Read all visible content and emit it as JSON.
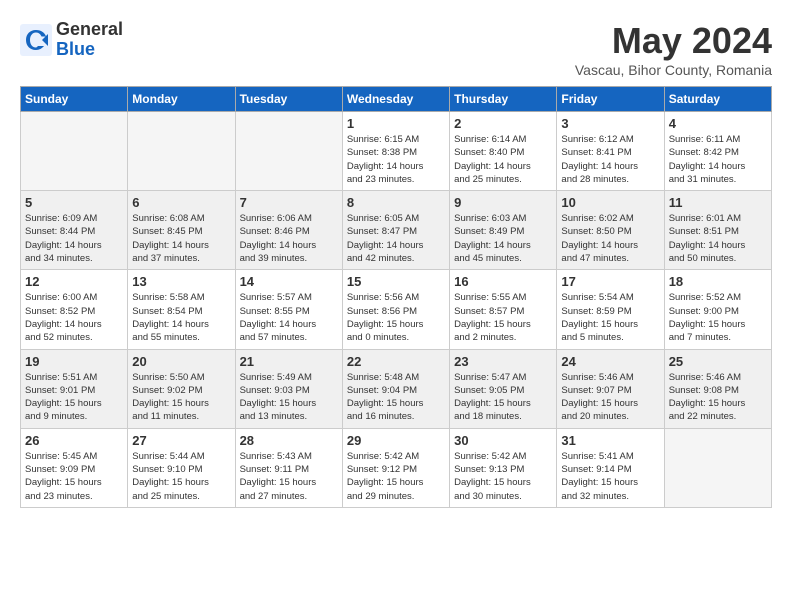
{
  "logo": {
    "general": "General",
    "blue": "Blue"
  },
  "title": "May 2024",
  "subtitle": "Vascau, Bihor County, Romania",
  "weekdays": [
    "Sunday",
    "Monday",
    "Tuesday",
    "Wednesday",
    "Thursday",
    "Friday",
    "Saturday"
  ],
  "weeks": [
    [
      {
        "day": "",
        "info": ""
      },
      {
        "day": "",
        "info": ""
      },
      {
        "day": "",
        "info": ""
      },
      {
        "day": "1",
        "info": "Sunrise: 6:15 AM\nSunset: 8:38 PM\nDaylight: 14 hours\nand 23 minutes."
      },
      {
        "day": "2",
        "info": "Sunrise: 6:14 AM\nSunset: 8:40 PM\nDaylight: 14 hours\nand 25 minutes."
      },
      {
        "day": "3",
        "info": "Sunrise: 6:12 AM\nSunset: 8:41 PM\nDaylight: 14 hours\nand 28 minutes."
      },
      {
        "day": "4",
        "info": "Sunrise: 6:11 AM\nSunset: 8:42 PM\nDaylight: 14 hours\nand 31 minutes."
      }
    ],
    [
      {
        "day": "5",
        "info": "Sunrise: 6:09 AM\nSunset: 8:44 PM\nDaylight: 14 hours\nand 34 minutes."
      },
      {
        "day": "6",
        "info": "Sunrise: 6:08 AM\nSunset: 8:45 PM\nDaylight: 14 hours\nand 37 minutes."
      },
      {
        "day": "7",
        "info": "Sunrise: 6:06 AM\nSunset: 8:46 PM\nDaylight: 14 hours\nand 39 minutes."
      },
      {
        "day": "8",
        "info": "Sunrise: 6:05 AM\nSunset: 8:47 PM\nDaylight: 14 hours\nand 42 minutes."
      },
      {
        "day": "9",
        "info": "Sunrise: 6:03 AM\nSunset: 8:49 PM\nDaylight: 14 hours\nand 45 minutes."
      },
      {
        "day": "10",
        "info": "Sunrise: 6:02 AM\nSunset: 8:50 PM\nDaylight: 14 hours\nand 47 minutes."
      },
      {
        "day": "11",
        "info": "Sunrise: 6:01 AM\nSunset: 8:51 PM\nDaylight: 14 hours\nand 50 minutes."
      }
    ],
    [
      {
        "day": "12",
        "info": "Sunrise: 6:00 AM\nSunset: 8:52 PM\nDaylight: 14 hours\nand 52 minutes."
      },
      {
        "day": "13",
        "info": "Sunrise: 5:58 AM\nSunset: 8:54 PM\nDaylight: 14 hours\nand 55 minutes."
      },
      {
        "day": "14",
        "info": "Sunrise: 5:57 AM\nSunset: 8:55 PM\nDaylight: 14 hours\nand 57 minutes."
      },
      {
        "day": "15",
        "info": "Sunrise: 5:56 AM\nSunset: 8:56 PM\nDaylight: 15 hours\nand 0 minutes."
      },
      {
        "day": "16",
        "info": "Sunrise: 5:55 AM\nSunset: 8:57 PM\nDaylight: 15 hours\nand 2 minutes."
      },
      {
        "day": "17",
        "info": "Sunrise: 5:54 AM\nSunset: 8:59 PM\nDaylight: 15 hours\nand 5 minutes."
      },
      {
        "day": "18",
        "info": "Sunrise: 5:52 AM\nSunset: 9:00 PM\nDaylight: 15 hours\nand 7 minutes."
      }
    ],
    [
      {
        "day": "19",
        "info": "Sunrise: 5:51 AM\nSunset: 9:01 PM\nDaylight: 15 hours\nand 9 minutes."
      },
      {
        "day": "20",
        "info": "Sunrise: 5:50 AM\nSunset: 9:02 PM\nDaylight: 15 hours\nand 11 minutes."
      },
      {
        "day": "21",
        "info": "Sunrise: 5:49 AM\nSunset: 9:03 PM\nDaylight: 15 hours\nand 13 minutes."
      },
      {
        "day": "22",
        "info": "Sunrise: 5:48 AM\nSunset: 9:04 PM\nDaylight: 15 hours\nand 16 minutes."
      },
      {
        "day": "23",
        "info": "Sunrise: 5:47 AM\nSunset: 9:05 PM\nDaylight: 15 hours\nand 18 minutes."
      },
      {
        "day": "24",
        "info": "Sunrise: 5:46 AM\nSunset: 9:07 PM\nDaylight: 15 hours\nand 20 minutes."
      },
      {
        "day": "25",
        "info": "Sunrise: 5:46 AM\nSunset: 9:08 PM\nDaylight: 15 hours\nand 22 minutes."
      }
    ],
    [
      {
        "day": "26",
        "info": "Sunrise: 5:45 AM\nSunset: 9:09 PM\nDaylight: 15 hours\nand 23 minutes."
      },
      {
        "day": "27",
        "info": "Sunrise: 5:44 AM\nSunset: 9:10 PM\nDaylight: 15 hours\nand 25 minutes."
      },
      {
        "day": "28",
        "info": "Sunrise: 5:43 AM\nSunset: 9:11 PM\nDaylight: 15 hours\nand 27 minutes."
      },
      {
        "day": "29",
        "info": "Sunrise: 5:42 AM\nSunset: 9:12 PM\nDaylight: 15 hours\nand 29 minutes."
      },
      {
        "day": "30",
        "info": "Sunrise: 5:42 AM\nSunset: 9:13 PM\nDaylight: 15 hours\nand 30 minutes."
      },
      {
        "day": "31",
        "info": "Sunrise: 5:41 AM\nSunset: 9:14 PM\nDaylight: 15 hours\nand 32 minutes."
      },
      {
        "day": "",
        "info": ""
      }
    ]
  ]
}
